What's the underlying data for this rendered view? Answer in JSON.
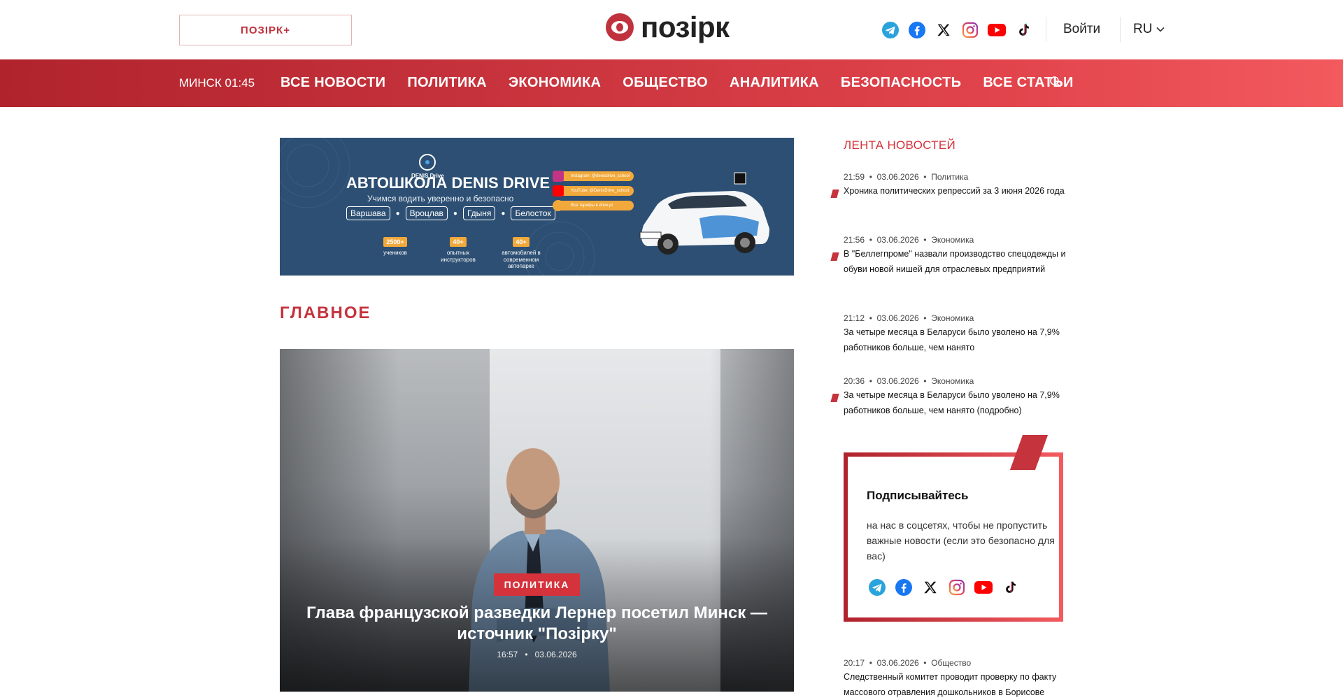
{
  "header": {
    "plus_button": "ПОЗІРК+",
    "logo_text": "позірк",
    "login": "Войти",
    "lang": "RU",
    "socials": [
      "telegram-icon",
      "facebook-icon",
      "x-icon",
      "instagram-icon",
      "youtube-icon",
      "tiktok-icon"
    ]
  },
  "nav": {
    "clock": "МИНСК 01:45",
    "items": [
      "ВСЕ НОВОСТИ",
      "ПОЛИТИКА",
      "ЭКОНОМИКА",
      "ОБЩЕСТВО",
      "АНАЛИТИКА",
      "БЕЗОПАСНОСТЬ",
      "ВСЕ СТАТЬИ"
    ]
  },
  "banner": {
    "brand": "DENIS Drive",
    "title": "АВТОШКОЛА DENIS DRIVE",
    "subtitle": "Учимся водить уверенно и безопасно",
    "cities": [
      "Варшава",
      "Вроцлав",
      "Гдыня",
      "Белосток"
    ],
    "stats": [
      {
        "num": "2500+",
        "label": "учеников"
      },
      {
        "num": "40+",
        "label": "опытных инструкторов"
      },
      {
        "num": "40+",
        "label": "автомобилей в современном автопарке"
      }
    ],
    "pills": [
      "Instagram: @denisdrive_school",
      "YouTube: @DenisDrive_school",
      "Все тарифы в drive.pl"
    ]
  },
  "main": {
    "section_title": "ГЛАВНОЕ",
    "hero": {
      "tag": "ПОЛИТИКА",
      "title": "Глава французской разведки Лернер посетил Минск — источник \"Позірку\"",
      "time": "16:57",
      "date": "03.06.2026"
    }
  },
  "sidebar": {
    "feed_title": "ЛЕНТА НОВОСТЕЙ",
    "items": [
      {
        "time": "21:59",
        "date": "03.06.2026",
        "category": "Политика",
        "title": "Хроника политических репрессий за 3 июня 2026 года",
        "marker": true
      },
      {
        "time": "21:56",
        "date": "03.06.2026",
        "category": "Экономика",
        "title": "В \"Беллегпроме\" назвали производство спецодежды и обуви новой нишей для отраслевых предприятий",
        "marker": true
      },
      {
        "time": "21:12",
        "date": "03.06.2026",
        "category": "Экономика",
        "title": "За четыре месяца в Беларуси было уволено на 7,9% работников больше, чем нанято",
        "marker": false
      },
      {
        "time": "20:36",
        "date": "03.06.2026",
        "category": "Экономика",
        "title": "За четыре месяца в Беларуси было уволено на 7,9% работников больше, чем нанято (подробно)",
        "marker": true
      }
    ],
    "subscribe": {
      "title": "Подписывайтесь",
      "text": "на нас в соцсетях, чтобы не пропустить важные новости (если это безопасно для вас)"
    },
    "bottom_item": {
      "time": "20:17",
      "date": "03.06.2026",
      "category": "Общество",
      "title": "Следственный комитет проводит проверку по факту массового отравления дошкольников в Борисове"
    }
  },
  "colors": {
    "accent": "#c5333c",
    "nav_start": "#b0232d",
    "nav_end": "#f25a5e"
  }
}
